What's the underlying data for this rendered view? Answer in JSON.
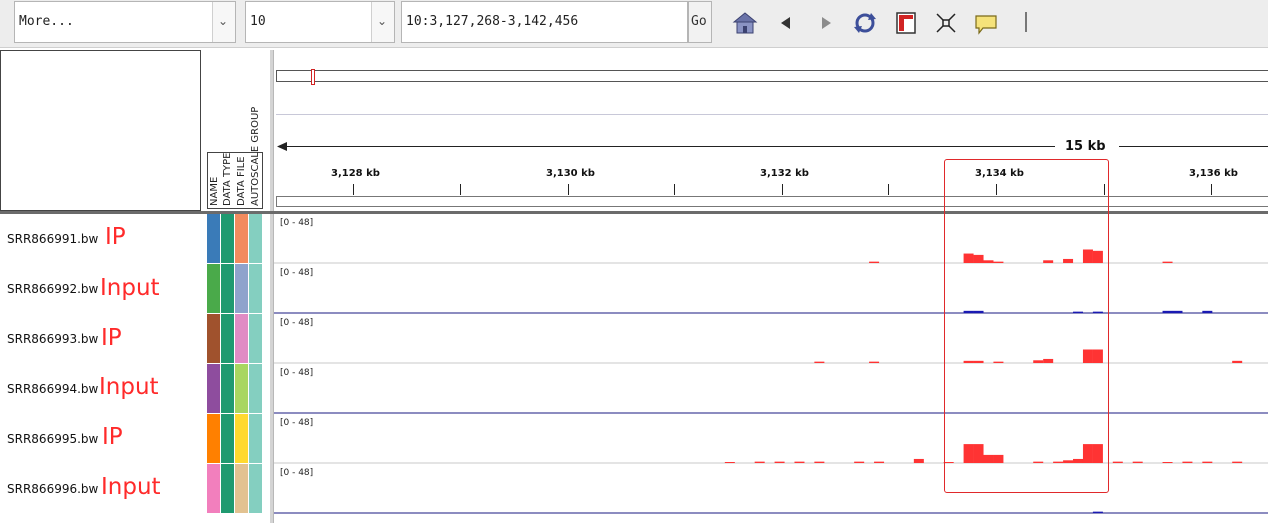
{
  "toolbar": {
    "chromosome_select": {
      "value": "More..."
    },
    "zoom_select": {
      "value": "10"
    },
    "locus_input": {
      "value": "10:3,127,268-3,142,456"
    },
    "go_label": "Go",
    "icons": [
      "home-icon",
      "back-arrow-icon",
      "forward-arrow-icon",
      "refresh-icon",
      "region-of-interest-icon",
      "resize-to-window-icon",
      "popup-info-icon"
    ]
  },
  "attribute_headers": [
    "NAME",
    "DATA TYPE",
    "DATA FILE",
    "AUTOSCALE GROUP"
  ],
  "ruler": {
    "span_label": "15 kb",
    "ticks": [
      "3,128 kb",
      "3,130 kb",
      "3,132 kb",
      "3,134 kb",
      "3,136 kb"
    ]
  },
  "tracks": [
    {
      "name": "SRR866991.bw",
      "annotation": "IP",
      "range": "[0 - 48]",
      "color": "#ff3333",
      "attr_colors": [
        "#3a7bb8",
        "#1f9a70",
        "#f28b5e",
        "#84cfc0"
      ],
      "bars": [
        [
          3133.25,
          0.5
        ],
        [
          3134.2,
          3.5
        ],
        [
          3134.3,
          3
        ],
        [
          3134.4,
          1
        ],
        [
          3134.5,
          0.5
        ],
        [
          3135.0,
          1
        ],
        [
          3135.2,
          1.5
        ],
        [
          3135.4,
          5
        ],
        [
          3135.5,
          4.5
        ],
        [
          3136.2,
          0.5
        ]
      ]
    },
    {
      "name": "SRR866992.bw",
      "annotation": "Input",
      "range": "[0 - 48]",
      "color": "#1a1ab3",
      "attr_colors": [
        "#4aaa4a",
        "#1f9a70",
        "#8fa3cc",
        "#84cfc0"
      ],
      "bars": [
        [
          3134.2,
          0.8
        ],
        [
          3134.3,
          0.8
        ],
        [
          3135.3,
          0.5
        ],
        [
          3135.5,
          0.5
        ],
        [
          3136.2,
          0.8
        ],
        [
          3136.3,
          0.8
        ],
        [
          3136.6,
          0.8
        ]
      ]
    },
    {
      "name": "SRR866993.bw",
      "annotation": "IP",
      "range": "[0 - 48]",
      "color": "#ff3333",
      "attr_colors": [
        "#a0522d",
        "#1f9a70",
        "#e08cc4",
        "#84cfc0"
      ],
      "bars": [
        [
          3132.7,
          0.5
        ],
        [
          3133.25,
          0.5
        ],
        [
          3134.2,
          0.8
        ],
        [
          3134.3,
          0.8
        ],
        [
          3134.5,
          0.5
        ],
        [
          3134.9,
          1
        ],
        [
          3135.0,
          1.5
        ],
        [
          3135.4,
          5
        ],
        [
          3135.5,
          5
        ],
        [
          3136.9,
          0.8
        ],
        [
          3137.6,
          0.5
        ]
      ]
    },
    {
      "name": "SRR866994.bw",
      "annotation": "Input",
      "range": "[0 - 48]",
      "color": "#1a1ab3",
      "attr_colors": [
        "#8e4d9e",
        "#1f9a70",
        "#a8d660",
        "#84cfc0"
      ],
      "bars": []
    },
    {
      "name": "SRR866995.bw",
      "annotation": "IP",
      "range": "[0 - 48]",
      "color": "#ff3333",
      "attr_colors": [
        "#ff8000",
        "#1f9a70",
        "#ffd92f",
        "#84cfc0"
      ],
      "bars": [
        [
          3131.8,
          0.3
        ],
        [
          3132.1,
          0.5
        ],
        [
          3132.3,
          0.5
        ],
        [
          3132.5,
          0.5
        ],
        [
          3132.7,
          0.5
        ],
        [
          3133.1,
          0.5
        ],
        [
          3133.3,
          0.5
        ],
        [
          3133.7,
          1.5
        ],
        [
          3134.0,
          0.3
        ],
        [
          3134.2,
          7
        ],
        [
          3134.3,
          7
        ],
        [
          3134.4,
          3
        ],
        [
          3134.5,
          3
        ],
        [
          3134.9,
          0.5
        ],
        [
          3135.1,
          0.5
        ],
        [
          3135.2,
          1
        ],
        [
          3135.3,
          1.5
        ],
        [
          3135.4,
          7
        ],
        [
          3135.5,
          7
        ],
        [
          3135.7,
          0.5
        ],
        [
          3135.9,
          0.5
        ],
        [
          3136.2,
          0.3
        ],
        [
          3136.4,
          0.5
        ],
        [
          3136.6,
          0.5
        ],
        [
          3136.9,
          0.5
        ],
        [
          3137.6,
          0.3
        ]
      ]
    },
    {
      "name": "SRR866996.bw",
      "annotation": "Input",
      "range": "[0 - 48]",
      "color": "#1a1ab3",
      "attr_colors": [
        "#f27fbd",
        "#1f9a70",
        "#e2c291",
        "#84cfc0"
      ],
      "bars": [
        [
          3135.5,
          0.5
        ]
      ]
    }
  ],
  "highlight_color": "#e0292b"
}
